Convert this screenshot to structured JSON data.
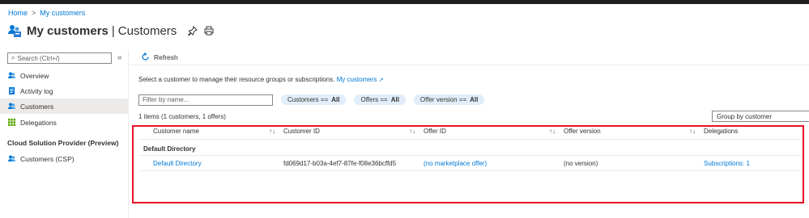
{
  "breadcrumb": {
    "home": "Home",
    "separator": ">",
    "current": "My customers"
  },
  "header": {
    "title": "My customers",
    "separator": "|",
    "subtitle": "Customers",
    "pin_icon": "pin-icon",
    "print_icon": "print-icon"
  },
  "sidebar": {
    "search_placeholder": "Search (Ctrl+/)",
    "collapse_label": "«",
    "items": [
      {
        "label": "Overview",
        "icon": "people-icon",
        "active": false
      },
      {
        "label": "Activity log",
        "icon": "log-icon",
        "active": false
      },
      {
        "label": "Customers",
        "icon": "people-icon",
        "active": true
      },
      {
        "label": "Delegations",
        "icon": "grid-icon",
        "active": false
      }
    ],
    "section_title": "Cloud Solution Provider (Preview)",
    "section_items": [
      {
        "label": "Customers (CSP)",
        "icon": "people-icon"
      }
    ]
  },
  "toolbar": {
    "refresh_label": "Refresh"
  },
  "main": {
    "intro_text": "Select a customer to manage their resource groups or subscriptions.",
    "intro_link": "My customers",
    "filter_placeholder": "Filter by name...",
    "pills": [
      {
        "label": "Customers ==",
        "value": "All"
      },
      {
        "label": "Offers ==",
        "value": "All"
      },
      {
        "label": "Offer version ==",
        "value": "All"
      }
    ],
    "count_text": "1 items (1 customers, 1 offers)",
    "group_by": "Group by customer"
  },
  "table": {
    "columns": [
      "Customer name",
      "Customer ID",
      "Offer ID",
      "Offer version",
      "Delegations"
    ],
    "sort_icon": "↑↓",
    "group_label": "Default Directory",
    "rows": [
      {
        "customer_name": "Default Directory",
        "customer_id": "fd069d17-b03a-4ef7-87fe-f08e36bcffd5",
        "offer_id": "(no marketplace offer)",
        "offer_version": "(no version)",
        "delegations": "Subscriptions: 1"
      }
    ]
  },
  "colors": {
    "accent": "#0078d4",
    "highlight": "#e81123",
    "pill_bg": "#e1eef9"
  }
}
